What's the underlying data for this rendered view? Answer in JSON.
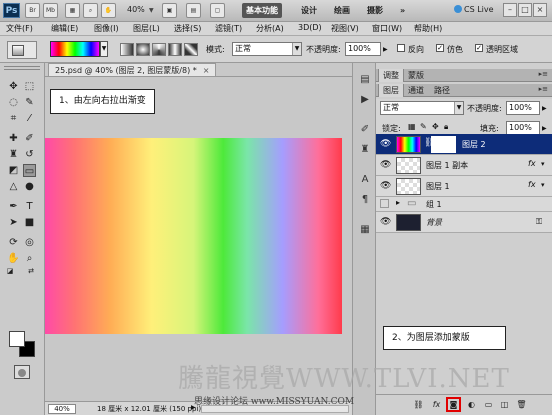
{
  "titlebar": {
    "logo": "Ps",
    "br_label": "Br",
    "mb_label": "Mb",
    "zoom": "40%",
    "workspaces": [
      "基本功能",
      "设计",
      "绘画",
      "摄影"
    ],
    "active_workspace": 0,
    "more": "»",
    "cs_live": "CS Live",
    "minimize": "–",
    "restore": "□",
    "close": "×"
  },
  "menu": {
    "items": [
      "文件(F)",
      "编辑(E)",
      "图像(I)",
      "图层(L)",
      "选择(S)",
      "滤镜(T)",
      "分析(A)",
      "3D(D)",
      "视图(V)",
      "窗口(W)",
      "帮助(H)"
    ]
  },
  "options": {
    "mode_label": "模式:",
    "mode_value": "正常",
    "opacity_label": "不透明度:",
    "opacity_value": "100%",
    "reverse_label": "反向",
    "dither_label": "仿色",
    "transparency_label": "透明区域",
    "reverse_checked": false,
    "dither_checked": true,
    "transparency_checked": true
  },
  "document": {
    "tab_title": "25.psd @ 40% (图层 2, 图层蒙版/8) *",
    "tab_close": "×",
    "zoom": "40%",
    "doc_size": "18 厘米 x 12.01 厘米 (150 ppi)"
  },
  "callouts": {
    "step1": "1、由左向右拉出渐变",
    "step2": "2、为图层添加蒙版"
  },
  "panel": {
    "top_tabs": [
      "调整",
      "蒙版"
    ],
    "tabs": [
      "图层",
      "通道",
      "路径"
    ],
    "blend_mode": "正常",
    "opacity_label": "不透明度:",
    "opacity_value": "100%",
    "lock_label": "锁定:",
    "fill_label": "填充:",
    "fill_value": "100%",
    "layers": [
      {
        "name": "图层 2",
        "selected": true,
        "visible": true,
        "has_mask": true,
        "fx": false
      },
      {
        "name": "图层 1 副本",
        "selected": false,
        "visible": true,
        "has_mask": false,
        "fx": true
      },
      {
        "name": "图层 1",
        "selected": false,
        "visible": true,
        "has_mask": false,
        "fx": true
      },
      {
        "name": "组 1",
        "selected": false,
        "visible": false,
        "group": true
      },
      {
        "name": "背景",
        "selected": false,
        "visible": true,
        "locked": true
      }
    ],
    "fx_symbol": "fx"
  },
  "watermark": {
    "main": "騰龍視覺WWW.TLVI.NET",
    "sub": "思缘设计论坛 www.MISSYUAN.COM"
  },
  "colors": {
    "selected_layer": "#0d2c79",
    "highlight_red": "#e10000"
  }
}
